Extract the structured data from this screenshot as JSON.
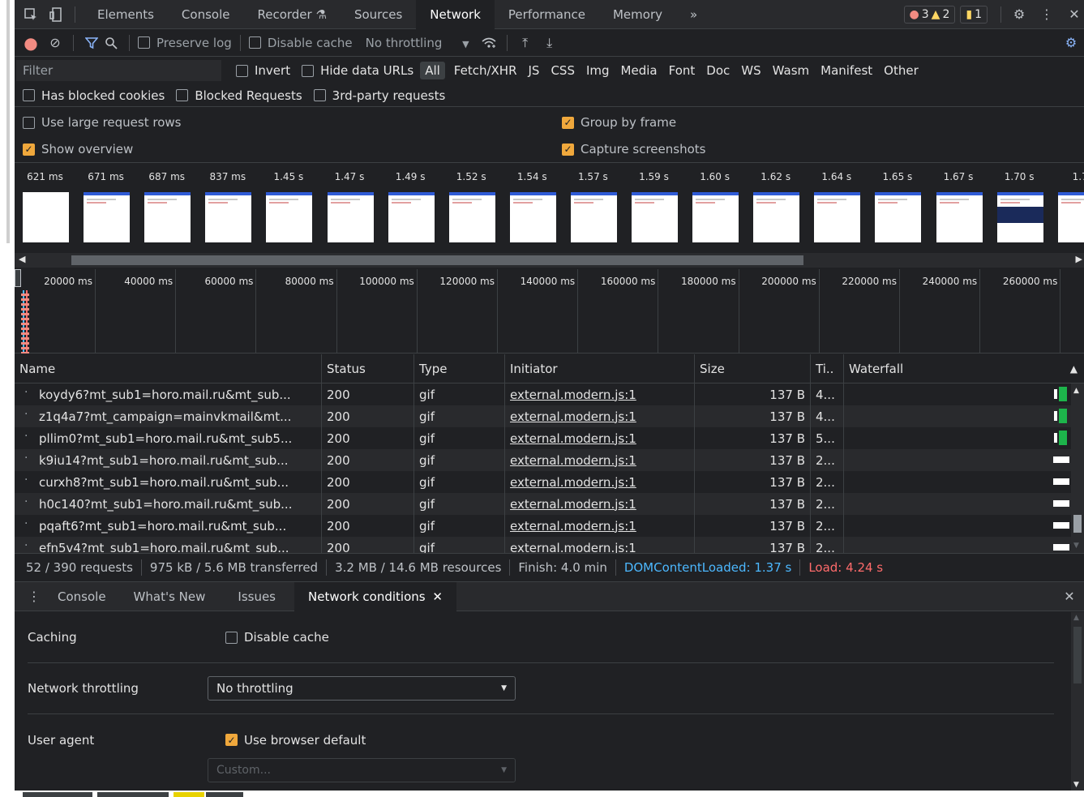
{
  "tabs": [
    "Elements",
    "Console",
    "Recorder",
    "Sources",
    "Network",
    "Performance",
    "Memory"
  ],
  "active_tab": "Network",
  "badges": {
    "errors": "3",
    "warnings": "2",
    "issues": "1"
  },
  "toolbar": {
    "preserve_log": "Preserve log",
    "disable_cache": "Disable cache",
    "throttling": "No throttling"
  },
  "filter": {
    "placeholder": "Filter",
    "invert": "Invert",
    "hide_data_urls": "Hide data URLs",
    "types": [
      "All",
      "Fetch/XHR",
      "JS",
      "CSS",
      "Img",
      "Media",
      "Font",
      "Doc",
      "WS",
      "Wasm",
      "Manifest",
      "Other"
    ],
    "selected_type": "All"
  },
  "cookie_filters": {
    "blocked_cookies": "Has blocked cookies",
    "blocked_requests": "Blocked Requests",
    "third_party": "3rd-party requests"
  },
  "settings": {
    "large_rows": "Use large request rows",
    "show_overview": "Show overview",
    "group_by_frame": "Group by frame",
    "capture_screenshots": "Capture screenshots"
  },
  "screenshots": [
    "621 ms",
    "671 ms",
    "687 ms",
    "837 ms",
    "1.45 s",
    "1.47 s",
    "1.49 s",
    "1.52 s",
    "1.54 s",
    "1.57 s",
    "1.59 s",
    "1.60 s",
    "1.62 s",
    "1.64 s",
    "1.65 s",
    "1.67 s",
    "1.70 s",
    "1.7"
  ],
  "overview_ticks": [
    "20000 ms",
    "40000 ms",
    "60000 ms",
    "80000 ms",
    "100000 ms",
    "120000 ms",
    "140000 ms",
    "160000 ms",
    "180000 ms",
    "200000 ms",
    "220000 ms",
    "240000 ms",
    "260000 ms"
  ],
  "columns": {
    "name": "Name",
    "status": "Status",
    "type": "Type",
    "initiator": "Initiator",
    "size": "Size",
    "time": "Ti..",
    "waterfall": "Waterfall"
  },
  "requests": [
    {
      "name": "koydy6?mt_sub1=horo.mail.ru&mt_sub...",
      "status": "200",
      "type": "gif",
      "initiator": "external.modern.js:1",
      "size": "137 B",
      "time": "4..."
    },
    {
      "name": "z1q4a7?mt_campaign=mainvkmail&mt...",
      "status": "200",
      "type": "gif",
      "initiator": "external.modern.js:1",
      "size": "137 B",
      "time": "4..."
    },
    {
      "name": "pllim0?mt_sub1=horo.mail.ru&mt_sub5...",
      "status": "200",
      "type": "gif",
      "initiator": "external.modern.js:1",
      "size": "137 B",
      "time": "5..."
    },
    {
      "name": "k9iu14?mt_sub1=horo.mail.ru&mt_sub...",
      "status": "200",
      "type": "gif",
      "initiator": "external.modern.js:1",
      "size": "137 B",
      "time": "2..."
    },
    {
      "name": "curxh8?mt_sub1=horo.mail.ru&mt_sub...",
      "status": "200",
      "type": "gif",
      "initiator": "external.modern.js:1",
      "size": "137 B",
      "time": "2..."
    },
    {
      "name": "h0c140?mt_sub1=horo.mail.ru&mt_sub...",
      "status": "200",
      "type": "gif",
      "initiator": "external.modern.js:1",
      "size": "137 B",
      "time": "2..."
    },
    {
      "name": "pqaft6?mt_sub1=horo.mail.ru&mt_sub...",
      "status": "200",
      "type": "gif",
      "initiator": "external.modern.js:1",
      "size": "137 B",
      "time": "2..."
    },
    {
      "name": "efn5v4?mt_sub1=horo.mail.ru&mt_sub...",
      "status": "200",
      "type": "gif",
      "initiator": "external.modern.js:1",
      "size": "137 B",
      "time": "2..."
    }
  ],
  "summary": {
    "requests": "52 / 390 requests",
    "transferred": "975 kB / 5.6 MB transferred",
    "resources": "3.2 MB / 14.6 MB resources",
    "finish": "Finish: 4.0 min",
    "dom": "DOMContentLoaded: 1.37 s",
    "load": "Load: 4.24 s"
  },
  "drawer": {
    "tabs": [
      "Console",
      "What's New",
      "Issues",
      "Network conditions"
    ],
    "active": "Network conditions"
  },
  "network_conditions": {
    "caching_label": "Caching",
    "disable_cache": "Disable cache",
    "throttling_label": "Network throttling",
    "throttling_value": "No throttling",
    "ua_label": "User agent",
    "ua_default": "Use browser default",
    "ua_custom": "Custom..."
  },
  "colors": {
    "accent": "#f0a83c",
    "dom_blue": "#4cb8ff",
    "load_red": "#ff6b6b",
    "waterfall_green": "#1db44b"
  }
}
